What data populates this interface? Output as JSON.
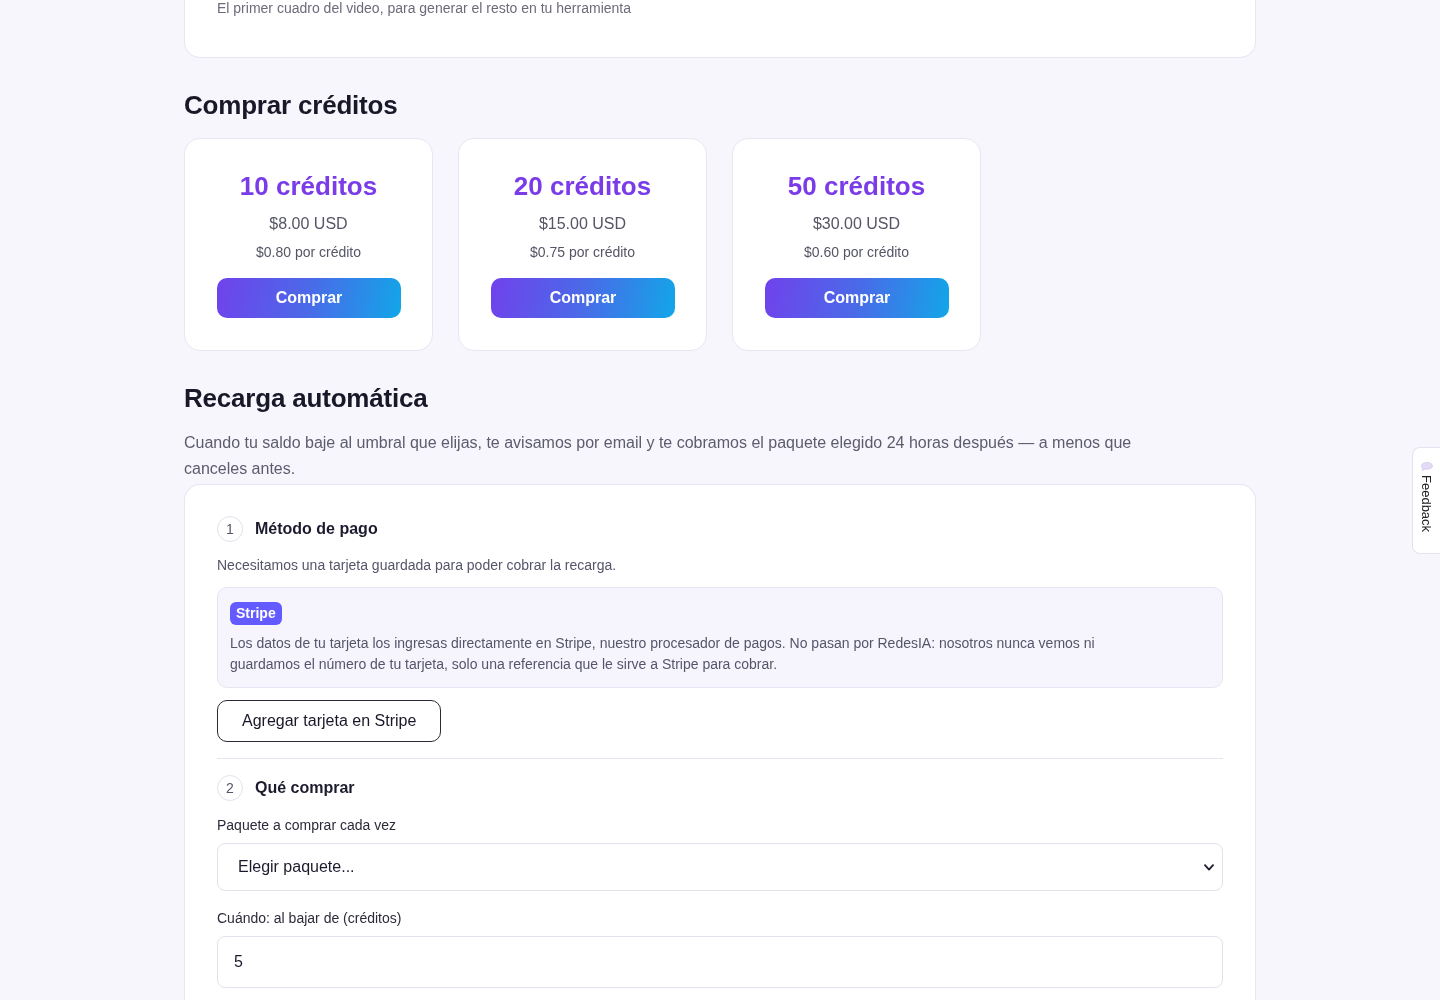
{
  "top_card": {
    "caption": "El primer cuadro del video, para generar el resto en tu herramienta"
  },
  "buy_credits": {
    "title": "Comprar créditos",
    "packages": [
      {
        "credits": "10 créditos",
        "price": "$8.00 USD",
        "unit_price": "$0.80 por crédito",
        "button": "Comprar"
      },
      {
        "credits": "20 créditos",
        "price": "$15.00 USD",
        "unit_price": "$0.75 por crédito",
        "button": "Comprar"
      },
      {
        "credits": "50 créditos",
        "price": "$30.00 USD",
        "unit_price": "$0.60 por crédito",
        "button": "Comprar"
      }
    ]
  },
  "auto_recharge": {
    "title": "Recarga automática",
    "description": "Cuando tu saldo baje al umbral que elijas, te avisamos por email y te cobramos el paquete elegido 24 horas después — a menos que canceles antes.",
    "steps": [
      {
        "kind": "payment",
        "number": "1",
        "title": "Método de pago",
        "description": "Necesitamos una tarjeta guardada para poder cobrar la recarga.",
        "notice": {
          "badge": "Stripe",
          "text": "Los datos de tu tarjeta los ingresas directamente en Stripe, nuestro procesador de pagos. No pasan por RedesIA: nosotros nunca vemos ni guardamos el número de tu tarjeta, solo una referencia que le sirve a Stripe para cobrar."
        },
        "button": "Agregar tarjeta en Stripe"
      },
      {
        "kind": "form",
        "number": "2",
        "title": "Qué comprar",
        "fields": [
          {
            "kind": "select",
            "label": "Paquete a comprar cada vez",
            "value": "Elegir paquete..."
          },
          {
            "kind": "number",
            "label": "Cuándo: al bajar de (créditos)",
            "value": "5"
          }
        ]
      }
    ]
  },
  "feedback_tab": {
    "label": "Feedback"
  }
}
